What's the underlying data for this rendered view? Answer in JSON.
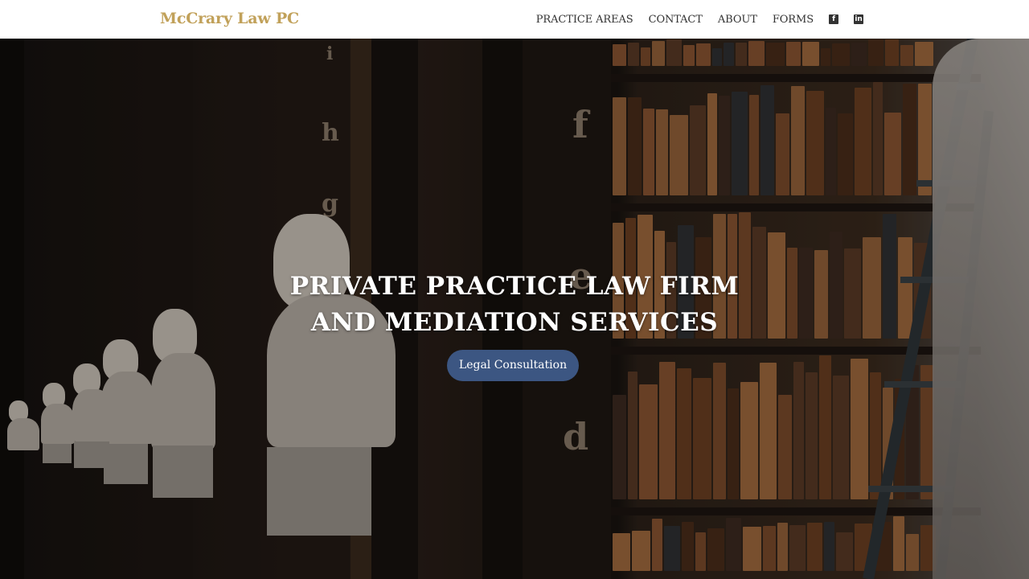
{
  "header": {
    "brand": "McCrary Law PC",
    "nav": [
      "PRACTICE AREAS",
      "CONTACT",
      "ABOUT",
      "FORMS"
    ],
    "social": [
      {
        "icon": "facebook-icon",
        "glyph": "f"
      },
      {
        "icon": "linkedin-icon",
        "glyph": "in"
      }
    ]
  },
  "hero": {
    "headline_line1": "PRIVATE PRACTICE LAW FIRM",
    "headline_line2": "AND MEDIATION SERVICES",
    "cta_label": "Legal Consultation",
    "shelf_letters": [
      "i",
      "h",
      "g",
      "f",
      "e",
      "d"
    ]
  },
  "colors": {
    "brand": "#c1a15a",
    "cta": "#3c5682"
  }
}
